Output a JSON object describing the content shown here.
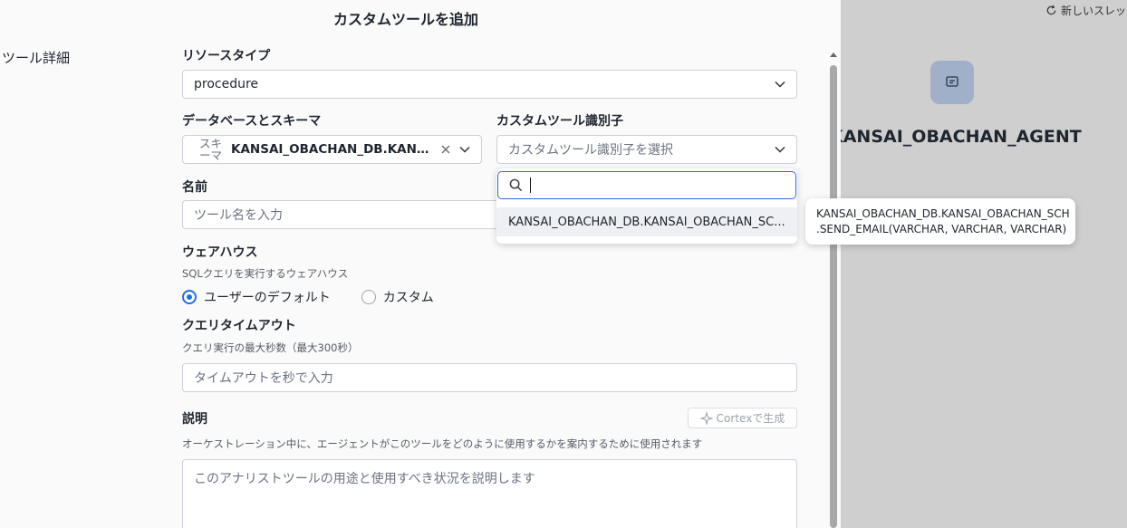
{
  "modal": {
    "title": "カスタムツールを追加",
    "section_title": "ツール詳細",
    "resource_type": {
      "label": "リソースタイプ",
      "value": "procedure"
    },
    "db_schema": {
      "label": "データベースとスキーマ",
      "chip": "スキーマ",
      "chip_line1": "スキ",
      "chip_line2": "ーマ",
      "value": "KANSAI_OBACHAN_DB.KANS..."
    },
    "tool_id": {
      "label": "カスタムツール識別子",
      "placeholder": "カスタムツール識別子を選択"
    },
    "name": {
      "label": "名前",
      "placeholder": "ツール名を入力"
    },
    "warehouse": {
      "label": "ウェアハウス",
      "help": "SQLクエリを実行するウェアハウス",
      "options": [
        {
          "label": "ユーザーのデフォルト",
          "selected": true
        },
        {
          "label": "カスタム",
          "selected": false
        }
      ]
    },
    "timeout": {
      "label": "クエリタイムアウト",
      "help": "クエリ実行の最大秒数（最大300秒）",
      "placeholder": "タイムアウトを秒で入力"
    },
    "description": {
      "label": "説明",
      "help": "オーケストレーション中に、エージェントがこのツールをどのように使用するかを案内するために使用されます",
      "placeholder": "このアナリストツールの用途と使用すべき状況を説明します",
      "generate_button": "Cortexで生成"
    },
    "dropdown": {
      "search_value": "",
      "items": [
        {
          "label": "KANSAI_OBACHAN_DB.KANSAI_OBACHAN_SC..."
        }
      ]
    },
    "tooltip": {
      "line1": "KANSAI_OBACHAN_DB.KANSAI_OBACHAN_SCH",
      "line2": ".SEND_EMAIL(VARCHAR, VARCHAR, VARCHAR)"
    }
  },
  "background": {
    "new_thread": "新しいスレッ",
    "agent_name": "KANSAI_OBACHAN_AGENT"
  },
  "colors": {
    "accent": "#1f6fe5",
    "overlay": "#cfcfcf",
    "agent_icon_bg": "#9fb0c8"
  }
}
